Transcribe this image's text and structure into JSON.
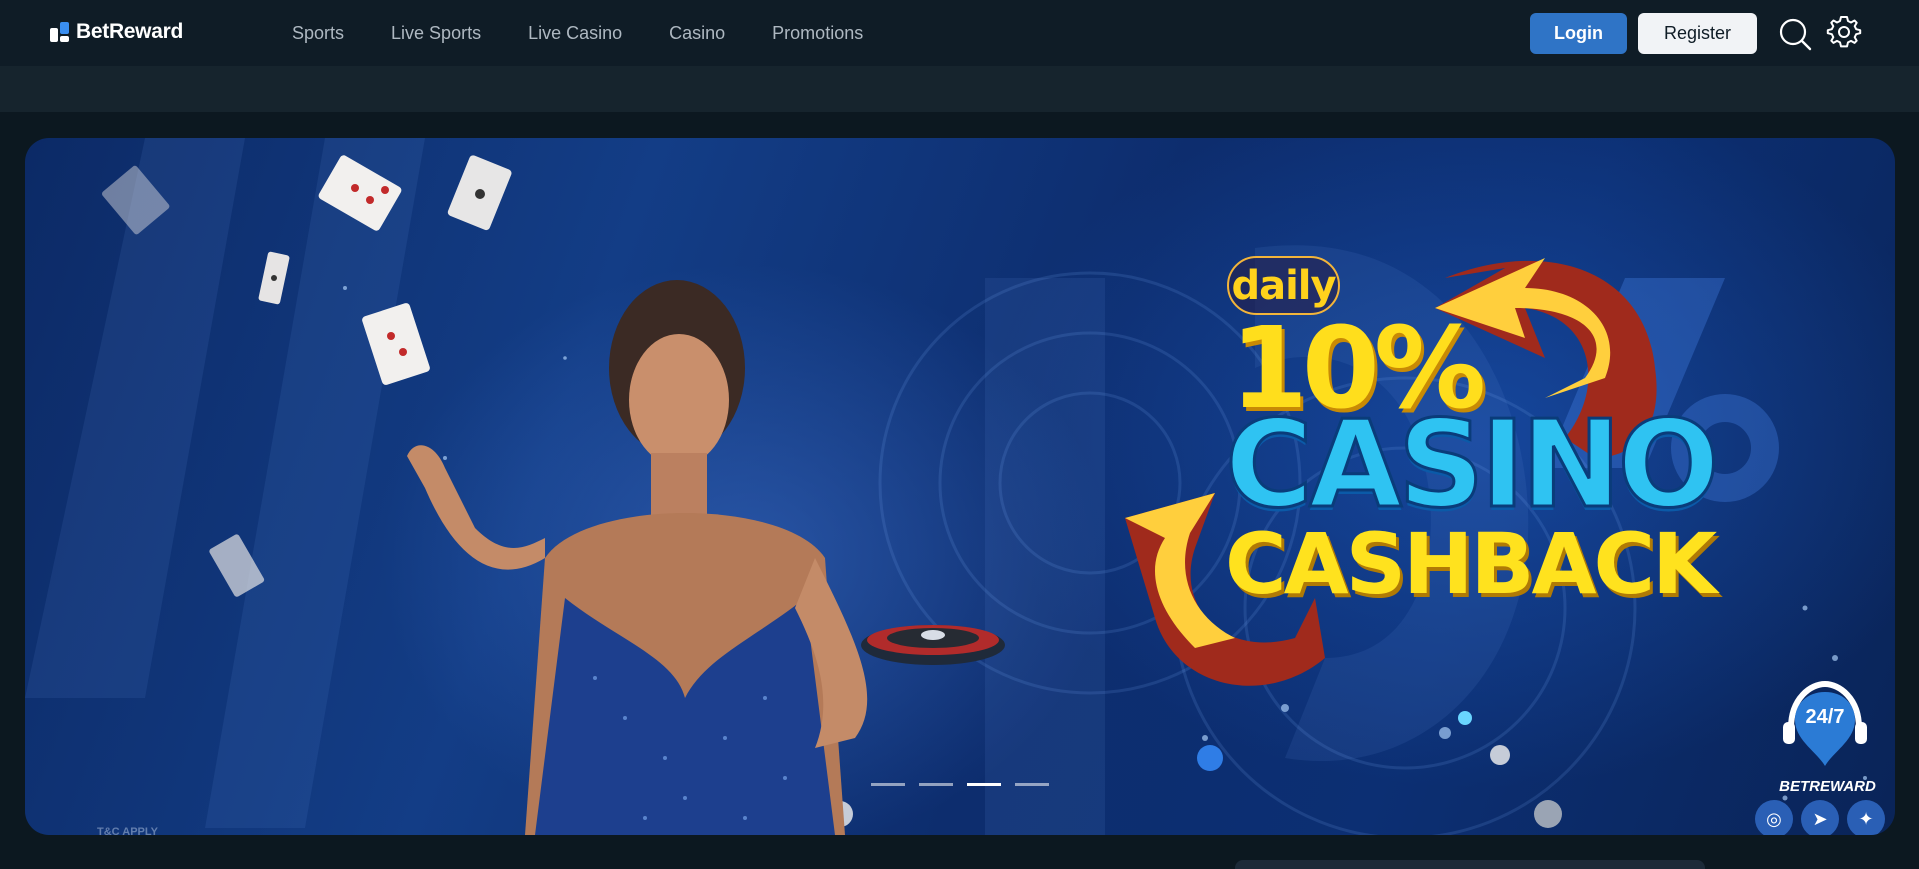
{
  "header": {
    "brand": "BetReward",
    "nav": [
      "Sports",
      "Live Sports",
      "Live Casino",
      "Casino",
      "Promotions"
    ],
    "login_label": "Login",
    "register_label": "Register"
  },
  "banner": {
    "daily": "daily",
    "percent": "10%",
    "casino": "CASINO",
    "cashback": "CASHBACK",
    "tc": "T&C APPLY",
    "slides": 4,
    "active_slide": 3
  },
  "support": {
    "label": "24/7",
    "brand": "BETREWARD",
    "social": [
      "instagram-icon",
      "telegram-icon",
      "chat-icon"
    ]
  },
  "colors": {
    "accent": "#2f74c6",
    "header_bg": "#0f1c26",
    "promo_yellow": "#ffde1c",
    "promo_cyan": "#2fc3f2"
  }
}
